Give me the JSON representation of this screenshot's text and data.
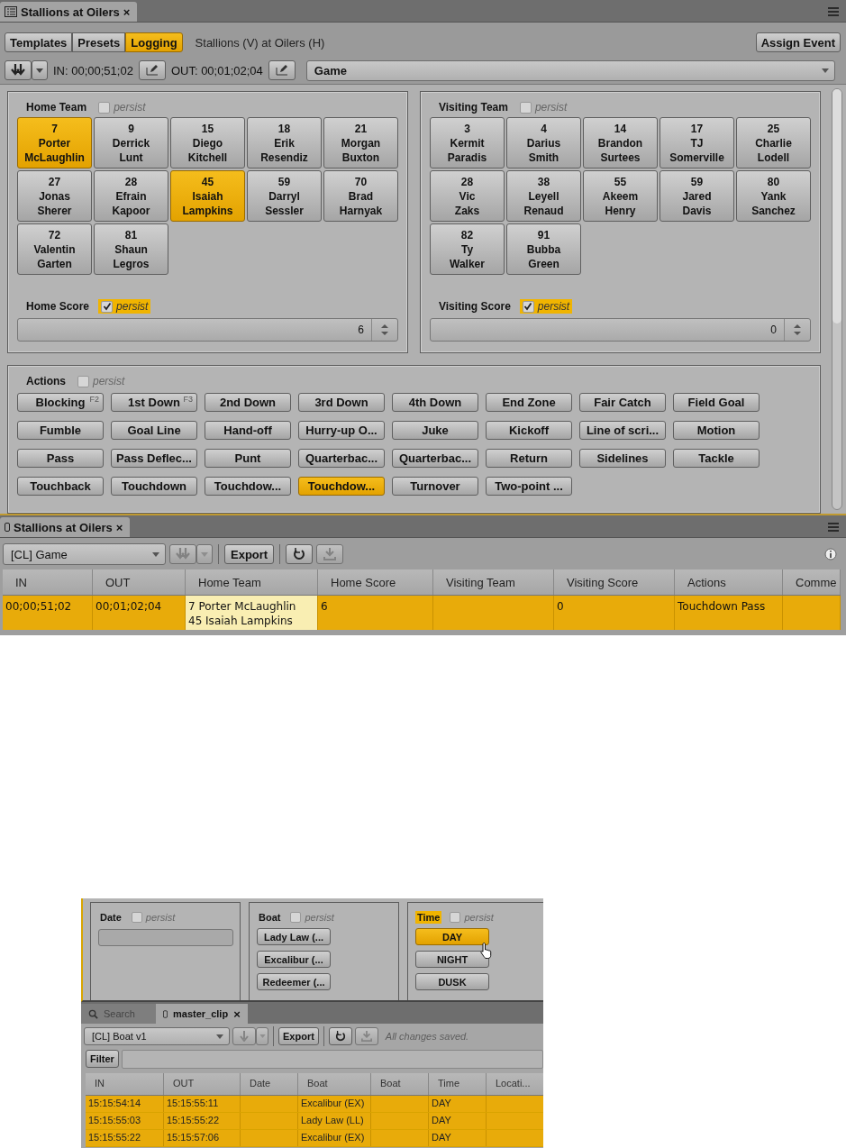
{
  "top_panel": {
    "tab": {
      "title": "Stallions at Oilers",
      "close": "×"
    },
    "mode_tabs": [
      {
        "label": "Templates",
        "selected": false
      },
      {
        "label": "Presets",
        "selected": false
      },
      {
        "label": "Logging",
        "selected": true
      }
    ],
    "event_title": "Stallions (V) at Oilers (H)",
    "assign_button": "Assign Event",
    "in_label": "IN: 00;00;51;02",
    "out_label": "OUT: 00;01;02;04",
    "event_type": "Game"
  },
  "teams": [
    {
      "title": "Home Team",
      "persist": {
        "label": "persist",
        "checked": false,
        "highlighted": false
      },
      "players": [
        {
          "number": "7",
          "first": "Porter",
          "last": "McLaughlin",
          "selected": true
        },
        {
          "number": "9",
          "first": "Derrick",
          "last": "Lunt",
          "selected": false
        },
        {
          "number": "15",
          "first": "Diego",
          "last": "Kitchell",
          "selected": false
        },
        {
          "number": "18",
          "first": "Erik",
          "last": "Resendiz",
          "selected": false
        },
        {
          "number": "21",
          "first": "Morgan",
          "last": "Buxton",
          "selected": false
        },
        {
          "number": "27",
          "first": "Jonas",
          "last": "Sherer",
          "selected": false
        },
        {
          "number": "28",
          "first": "Efrain",
          "last": "Kapoor",
          "selected": false
        },
        {
          "number": "45",
          "first": "Isaiah",
          "last": "Lampkins",
          "selected": true
        },
        {
          "number": "59",
          "first": "Darryl",
          "last": "Sessler",
          "selected": false
        },
        {
          "number": "70",
          "first": "Brad",
          "last": "Harnyak",
          "selected": false
        },
        {
          "number": "72",
          "first": "Valentin",
          "last": "Garten",
          "selected": false
        },
        {
          "number": "81",
          "first": "Shaun",
          "last": "Legros",
          "selected": false
        }
      ],
      "score": {
        "title": "Home Score",
        "persist": {
          "label": "persist",
          "checked": true,
          "highlighted": true
        },
        "value": "6"
      }
    },
    {
      "title": "Visiting Team",
      "persist": {
        "label": "persist",
        "checked": false,
        "highlighted": false
      },
      "players": [
        {
          "number": "3",
          "first": "Kermit",
          "last": "Paradis",
          "selected": false
        },
        {
          "number": "4",
          "first": "Darius",
          "last": "Smith",
          "selected": false
        },
        {
          "number": "14",
          "first": "Brandon",
          "last": "Surtees",
          "selected": false
        },
        {
          "number": "17",
          "first": "TJ",
          "last": "Somerville",
          "selected": false
        },
        {
          "number": "25",
          "first": "Charlie",
          "last": "Lodell",
          "selected": false
        },
        {
          "number": "28",
          "first": "Vic",
          "last": "Zaks",
          "selected": false
        },
        {
          "number": "38",
          "first": "Leyell",
          "last": "Renaud",
          "selected": false
        },
        {
          "number": "55",
          "first": "Akeem",
          "last": "Henry",
          "selected": false
        },
        {
          "number": "59",
          "first": "Jared",
          "last": "Davis",
          "selected": false
        },
        {
          "number": "80",
          "first": "Yank",
          "last": "Sanchez",
          "selected": false
        },
        {
          "number": "82",
          "first": "Ty",
          "last": "Walker",
          "selected": false
        },
        {
          "number": "91",
          "first": "Bubba",
          "last": "Green",
          "selected": false
        }
      ],
      "score": {
        "title": "Visiting Score",
        "persist": {
          "label": "persist",
          "checked": true,
          "highlighted": true
        },
        "value": "0"
      }
    }
  ],
  "actions": {
    "title": "Actions",
    "persist": {
      "label": "persist",
      "checked": false,
      "highlighted": false
    },
    "buttons": [
      {
        "label": "Blocking",
        "shortcut": "F2",
        "selected": false
      },
      {
        "label": "1st Down",
        "shortcut": "F3",
        "selected": false
      },
      {
        "label": "2nd Down",
        "selected": false
      },
      {
        "label": "3rd Down",
        "selected": false
      },
      {
        "label": "4th Down",
        "selected": false
      },
      {
        "label": "End Zone",
        "selected": false
      },
      {
        "label": "Fair Catch",
        "selected": false
      },
      {
        "label": "Field Goal",
        "selected": false
      },
      {
        "label": "Fumble",
        "selected": false
      },
      {
        "label": "Goal Line",
        "selected": false
      },
      {
        "label": "Hand-off",
        "selected": false
      },
      {
        "label": "Hurry-up O...",
        "selected": false
      },
      {
        "label": "Juke",
        "selected": false
      },
      {
        "label": "Kickoff",
        "selected": false
      },
      {
        "label": "Line of scri...",
        "selected": false
      },
      {
        "label": "Motion",
        "selected": false
      },
      {
        "label": "Pass",
        "selected": false
      },
      {
        "label": "Pass Deflec...",
        "selected": false
      },
      {
        "label": "Punt",
        "selected": false
      },
      {
        "label": "Quarterbac...",
        "selected": false
      },
      {
        "label": "Quarterbac...",
        "selected": false
      },
      {
        "label": "Return",
        "selected": false
      },
      {
        "label": "Sidelines",
        "selected": false
      },
      {
        "label": "Tackle",
        "selected": false
      },
      {
        "label": "Touchback",
        "selected": false
      },
      {
        "label": "Touchdown",
        "selected": false
      },
      {
        "label": "Touchdow...",
        "selected": false
      },
      {
        "label": "Touchdow...",
        "selected": true
      },
      {
        "label": "Turnover",
        "selected": false
      },
      {
        "label": "Two-point ...",
        "selected": false
      }
    ]
  },
  "log_panel": {
    "tab": {
      "title": "Stallions at Oilers",
      "close": "×"
    },
    "dropdown": "[CL] Game",
    "export": "Export",
    "columns": [
      "IN",
      "OUT",
      "Home Team",
      "Home Score",
      "Visiting Team",
      "Visiting Score",
      "Actions",
      "Comme"
    ],
    "rows": [
      {
        "selected": true,
        "cells": [
          {
            "text": "00;00;51;02",
            "focused": false
          },
          {
            "text": "00;01;02;04",
            "focused": false
          },
          {
            "text": "7 Porter McLaughlin\n45 Isaiah Lampkins",
            "focused": true
          },
          {
            "text": "6",
            "focused": false
          },
          {
            "text": "",
            "focused": false
          },
          {
            "text": "0",
            "focused": false
          },
          {
            "text": "Touchdown Pass",
            "focused": false
          },
          {
            "text": "",
            "focused": false
          }
        ]
      }
    ]
  },
  "inset": {
    "fields": [
      {
        "kind": "text",
        "title": "Date",
        "highlighted": false,
        "persist": {
          "label": "persist",
          "checked": false
        }
      },
      {
        "kind": "buttons",
        "title": "Boat",
        "highlighted": false,
        "persist": {
          "label": "persist",
          "checked": false
        },
        "buttons": [
          {
            "label": "Lady Law (...",
            "selected": false
          },
          {
            "label": "Excalibur (...",
            "selected": false
          },
          {
            "label": "Redeemer (...",
            "selected": false
          }
        ]
      },
      {
        "kind": "buttons",
        "title": "Time",
        "highlighted": true,
        "persist": {
          "label": "persist",
          "checked": false
        },
        "buttons": [
          {
            "label": "DAY",
            "selected": true
          },
          {
            "label": "NIGHT",
            "selected": false
          },
          {
            "label": "DUSK",
            "selected": false
          }
        ]
      }
    ],
    "tabs": [
      {
        "kind": "search",
        "label": "Search",
        "selected": false
      },
      {
        "kind": "clip",
        "label": "master_clip",
        "close": "×",
        "selected": true
      }
    ],
    "dropdown": "[CL] Boat v1",
    "export": "Export",
    "status": "All changes saved.",
    "filter": "Filter",
    "columns": [
      "IN",
      "OUT",
      "Date",
      "Boat",
      "Boat",
      "Time",
      "Locati..."
    ],
    "rows": [
      {
        "selected": true,
        "cells": [
          "15:15:54:14",
          "15:15:55:11",
          "",
          "Excalibur (EX)",
          "",
          "DAY",
          ""
        ]
      },
      {
        "selected": true,
        "cells": [
          "15:15:55:03",
          "15:15:55:22",
          "",
          "Lady Law (LL)",
          "",
          "DAY",
          ""
        ]
      },
      {
        "selected": true,
        "cells": [
          "15:15:55:22",
          "15:15:57:06",
          "",
          "Excalibur (EX)",
          "",
          "DAY",
          ""
        ]
      }
    ]
  }
}
